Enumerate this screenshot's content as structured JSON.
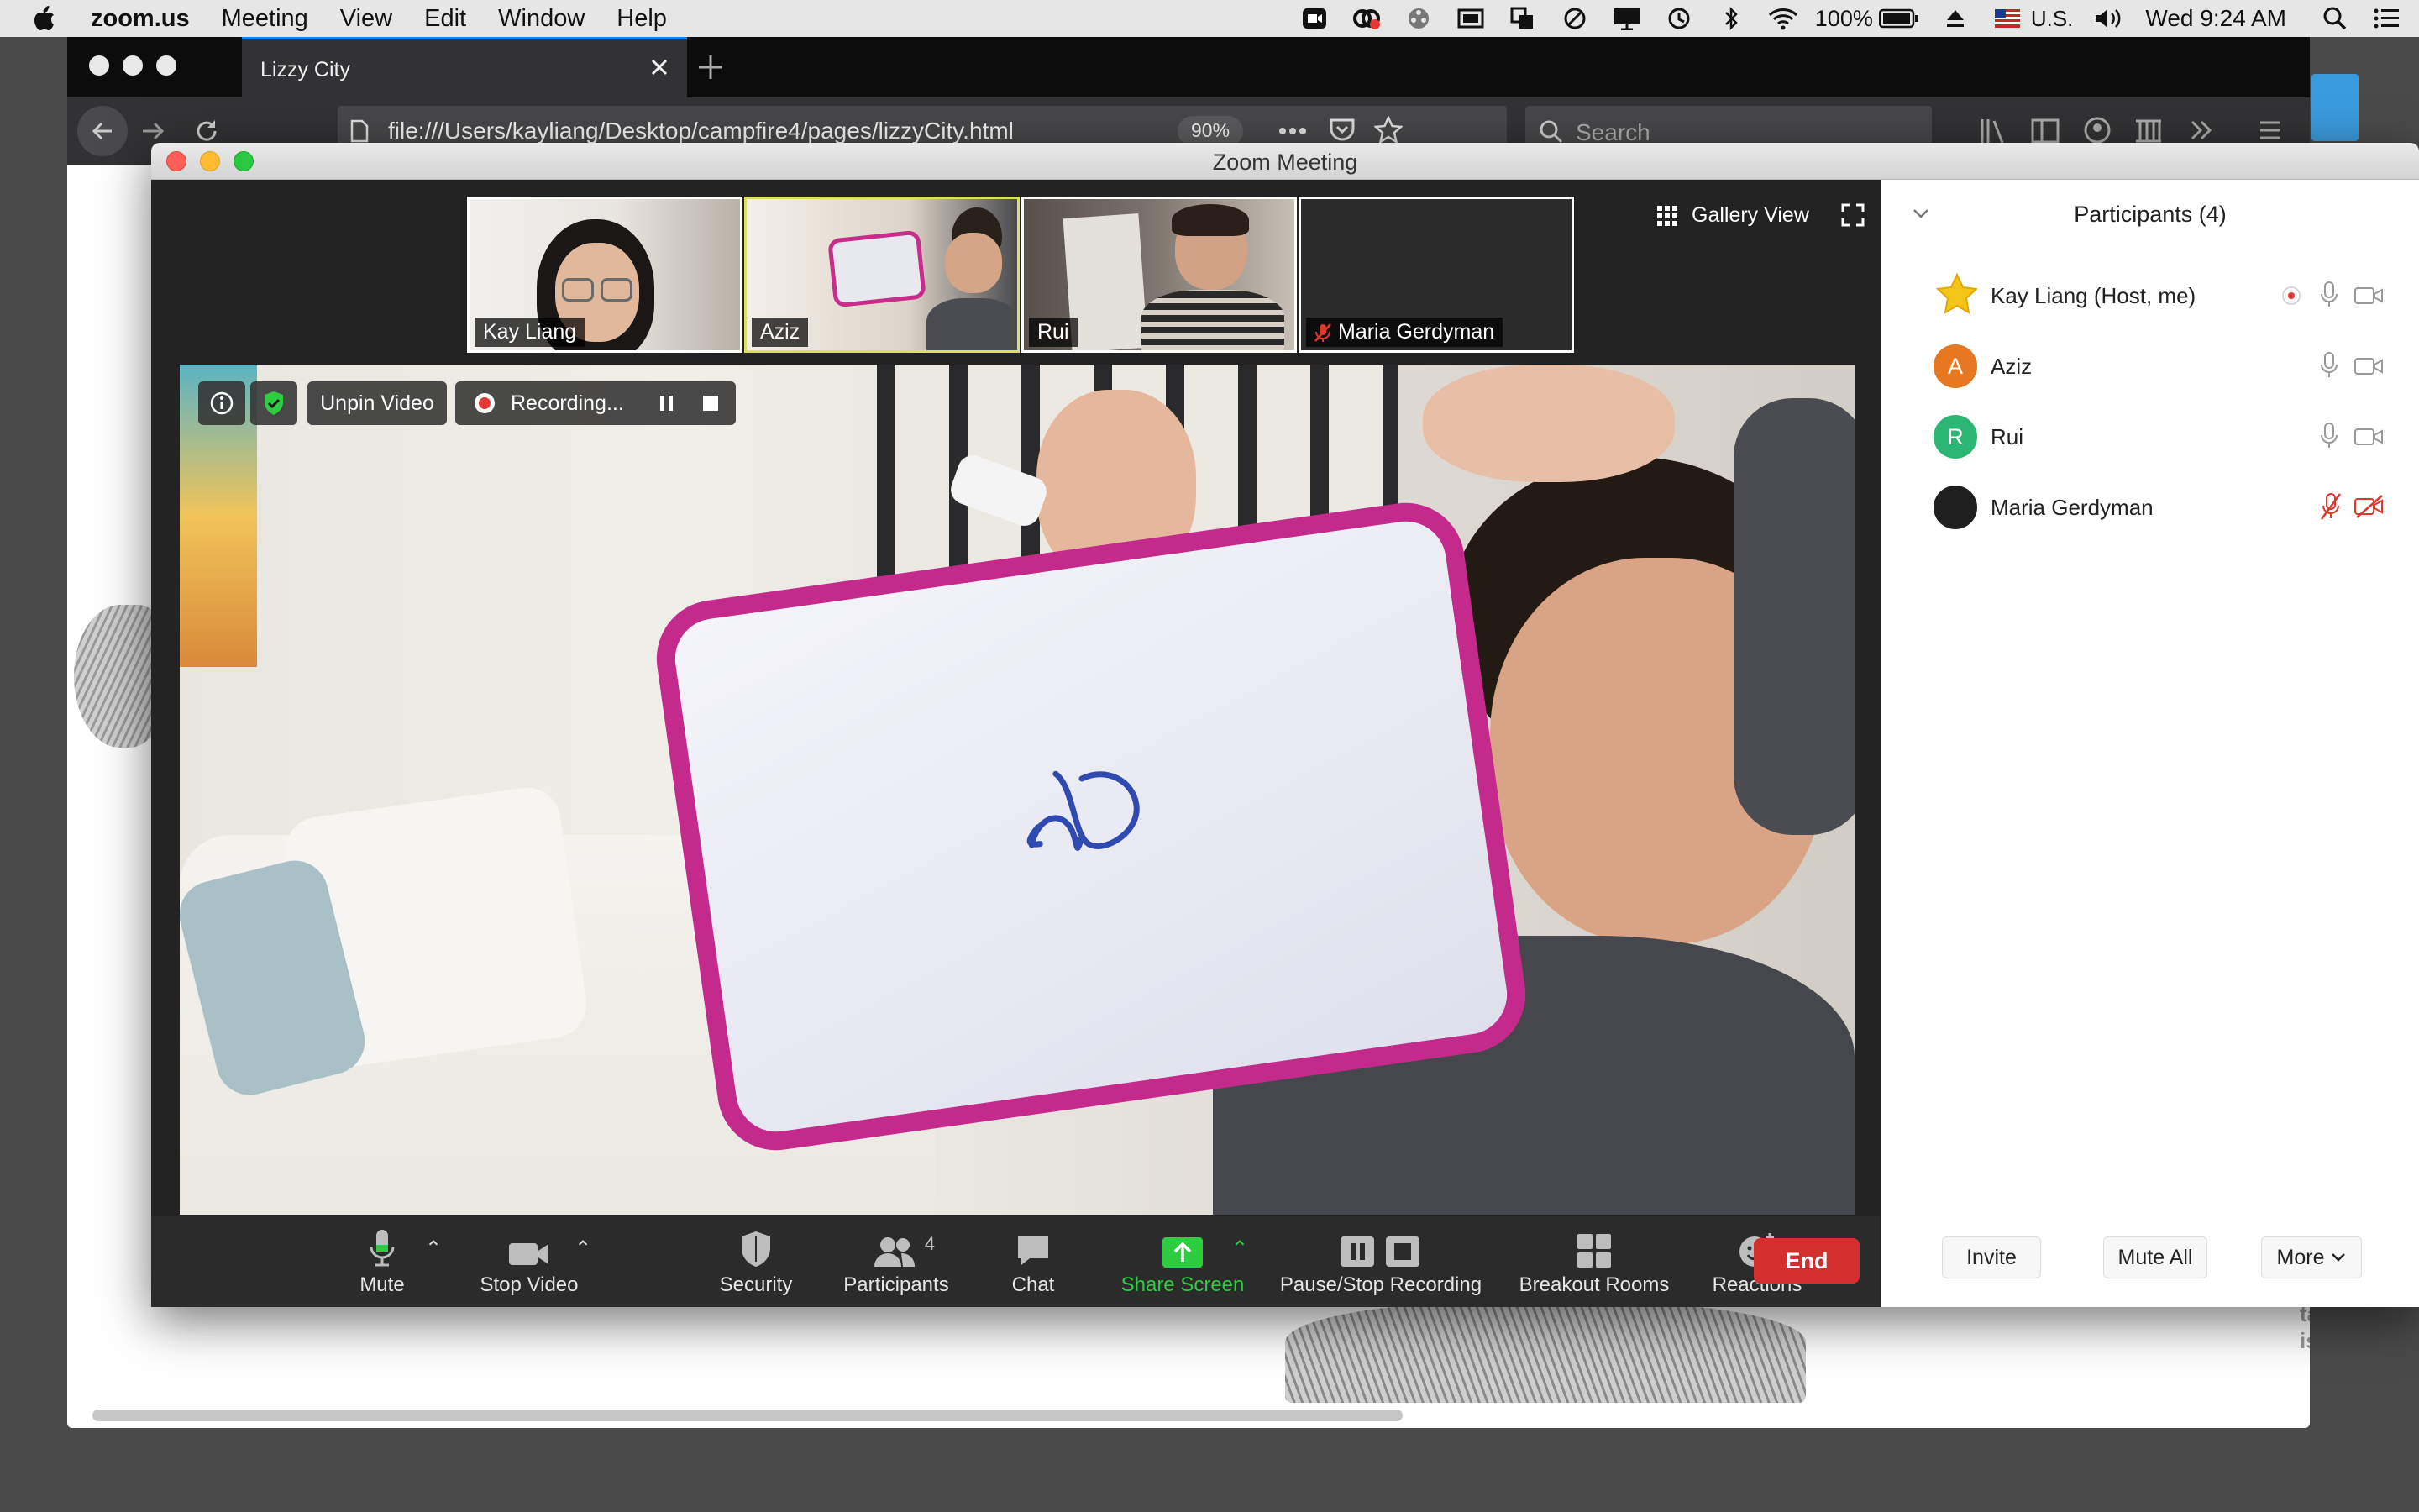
{
  "menubar": {
    "app": "zoom.us",
    "items": [
      "Meeting",
      "View",
      "Edit",
      "Window",
      "Help"
    ],
    "battery": "100%",
    "input_source": "U.S.",
    "clock": "Wed 9:24 AM"
  },
  "browser": {
    "tab_title": "Lizzy City",
    "url": "file:///Users/kayliang/Desktop/campfire4/pages/lizzyCity.html",
    "zoom_level": "90%",
    "search_placeholder": "Search",
    "page_fragment": [
      "tally",
      "ished"
    ]
  },
  "zoom": {
    "window_title": "Zoom Meeting",
    "gallery_view_label": "Gallery View",
    "thumbnails": [
      {
        "name": "Kay Liang"
      },
      {
        "name": "Aziz"
      },
      {
        "name": "Rui"
      },
      {
        "name": "Maria Gerdyman"
      }
    ],
    "overlay": {
      "unpin_label": "Unpin Video",
      "recording_label": "Recording..."
    },
    "toolbar": {
      "mute": "Mute",
      "stop_video": "Stop Video",
      "security": "Security",
      "participants": "Participants",
      "participants_count": "4",
      "chat": "Chat",
      "share_screen": "Share Screen",
      "pause_stop_recording": "Pause/Stop Recording",
      "breakout_rooms": "Breakout Rooms",
      "reactions": "Reactions",
      "end": "End"
    },
    "participants_panel": {
      "title": "Participants (4)",
      "people": [
        {
          "name": "Kay Liang (Host, me)",
          "initial": "",
          "color": "#f5c518"
        },
        {
          "name": "Aziz",
          "initial": "A",
          "color": "#e87722"
        },
        {
          "name": "Rui",
          "initial": "R",
          "color": "#2bb673"
        },
        {
          "name": "Maria Gerdyman",
          "initial": "",
          "color": "#1f1f1f"
        }
      ],
      "invite": "Invite",
      "mute_all": "Mute All",
      "more": "More"
    }
  },
  "colors": {
    "end_red": "#d32f2f",
    "share_green": "#2ecc40",
    "muted_red": "#e0362c"
  }
}
